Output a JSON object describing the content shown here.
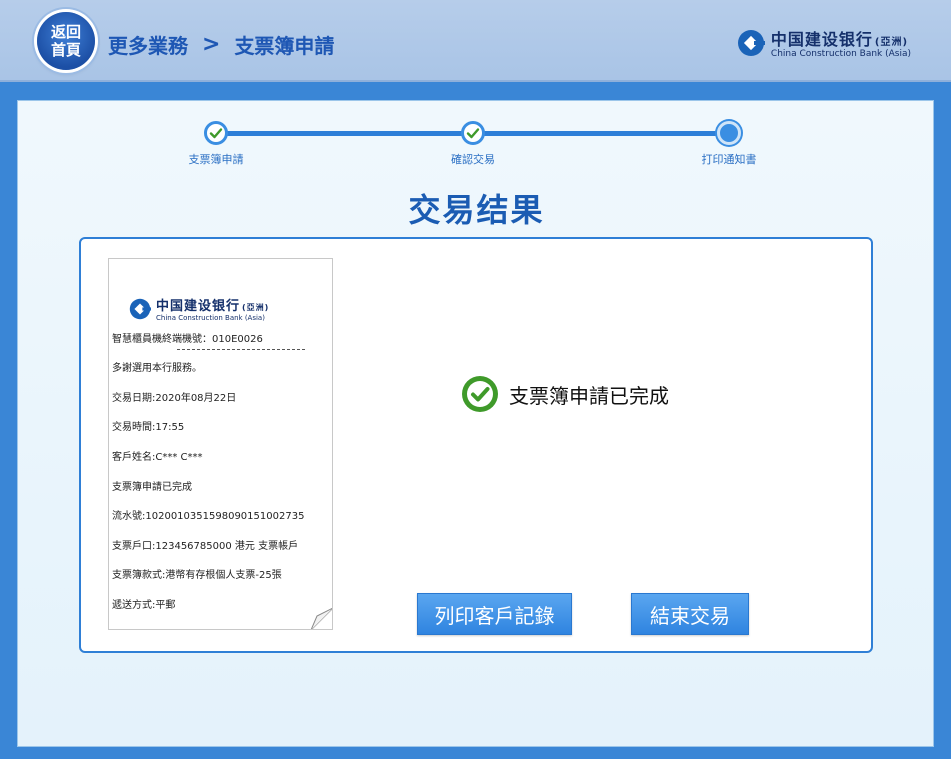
{
  "header": {
    "home_label_line1": "返回",
    "home_label_line2": "首頁",
    "breadcrumb": [
      "更多業務",
      "支票簿申請"
    ],
    "breadcrumb_separator": ">",
    "bank_name_cn": "中国建设银行",
    "bank_name_region": "(亞洲)",
    "bank_name_en": "China Construction Bank (Asia)"
  },
  "steps": [
    {
      "label": "支票簿申請",
      "state": "done"
    },
    {
      "label": "確認交易",
      "state": "done"
    },
    {
      "label": "打印通知書",
      "state": "current"
    }
  ],
  "result_title": "交易结果",
  "receipt": {
    "bank_name_cn": "中国建设银行",
    "bank_name_region": "(亞洲)",
    "bank_name_en": "China Construction Bank (Asia)",
    "lines": [
      "智慧櫃員機終端機號：010E0026",
      "多謝選用本行服務。",
      "交易日期:2020年08月22日",
      "交易時間:17:55",
      "客戶姓名:C*** C***",
      "支票簿申請已完成",
      "流水號:10200103515980901510027​35",
      "支票戶口:123456785000 港元 支票帳戶",
      "支票簿款式:港幣有存根個人支票-25張",
      "遞送方式:平郵"
    ]
  },
  "status": {
    "message": "支票簿申請已完成",
    "icon": "check-circle-icon"
  },
  "buttons": {
    "print_label": "列印客戶記錄",
    "end_label": "結束交易"
  },
  "colors": {
    "accent": "#2f84e0",
    "title": "#1b5cb3",
    "success": "#3f9a2a"
  }
}
